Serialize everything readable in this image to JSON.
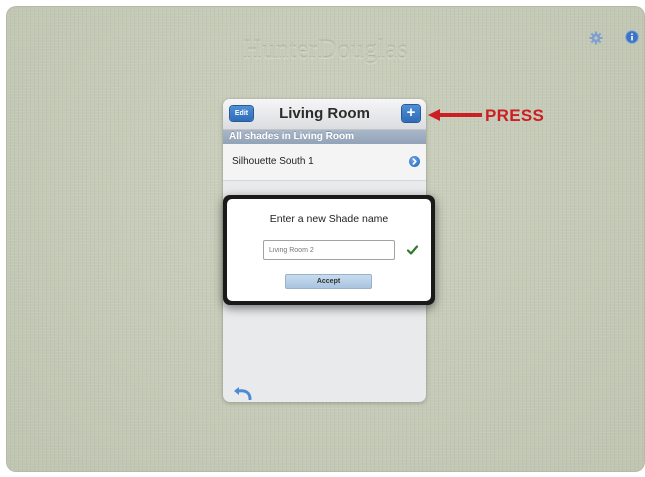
{
  "app": {
    "logo_text": "HunterDouglas"
  },
  "toolbar": {
    "settings_icon": "gear-icon",
    "info_icon": "info-icon"
  },
  "panel": {
    "edit_label": "Edit",
    "title": "Living Room",
    "add_label": "+",
    "section_header": "All shades in Living Room",
    "items": [
      {
        "label": "Silhouette South 1",
        "accessory": "disclosure-icon"
      }
    ],
    "back_icon": "back-arrow-icon"
  },
  "dialog": {
    "title": "Enter a new Shade name",
    "input_placeholder": "Living Room 2",
    "confirm_icon": "checkmark-icon",
    "accept_label": "Accept"
  },
  "annotation": {
    "label": "PRESS",
    "color": "#cc1f24"
  },
  "colors": {
    "accent": "#2f6cb8",
    "background": "#c3c9b6",
    "section": "#9aa9bc"
  }
}
